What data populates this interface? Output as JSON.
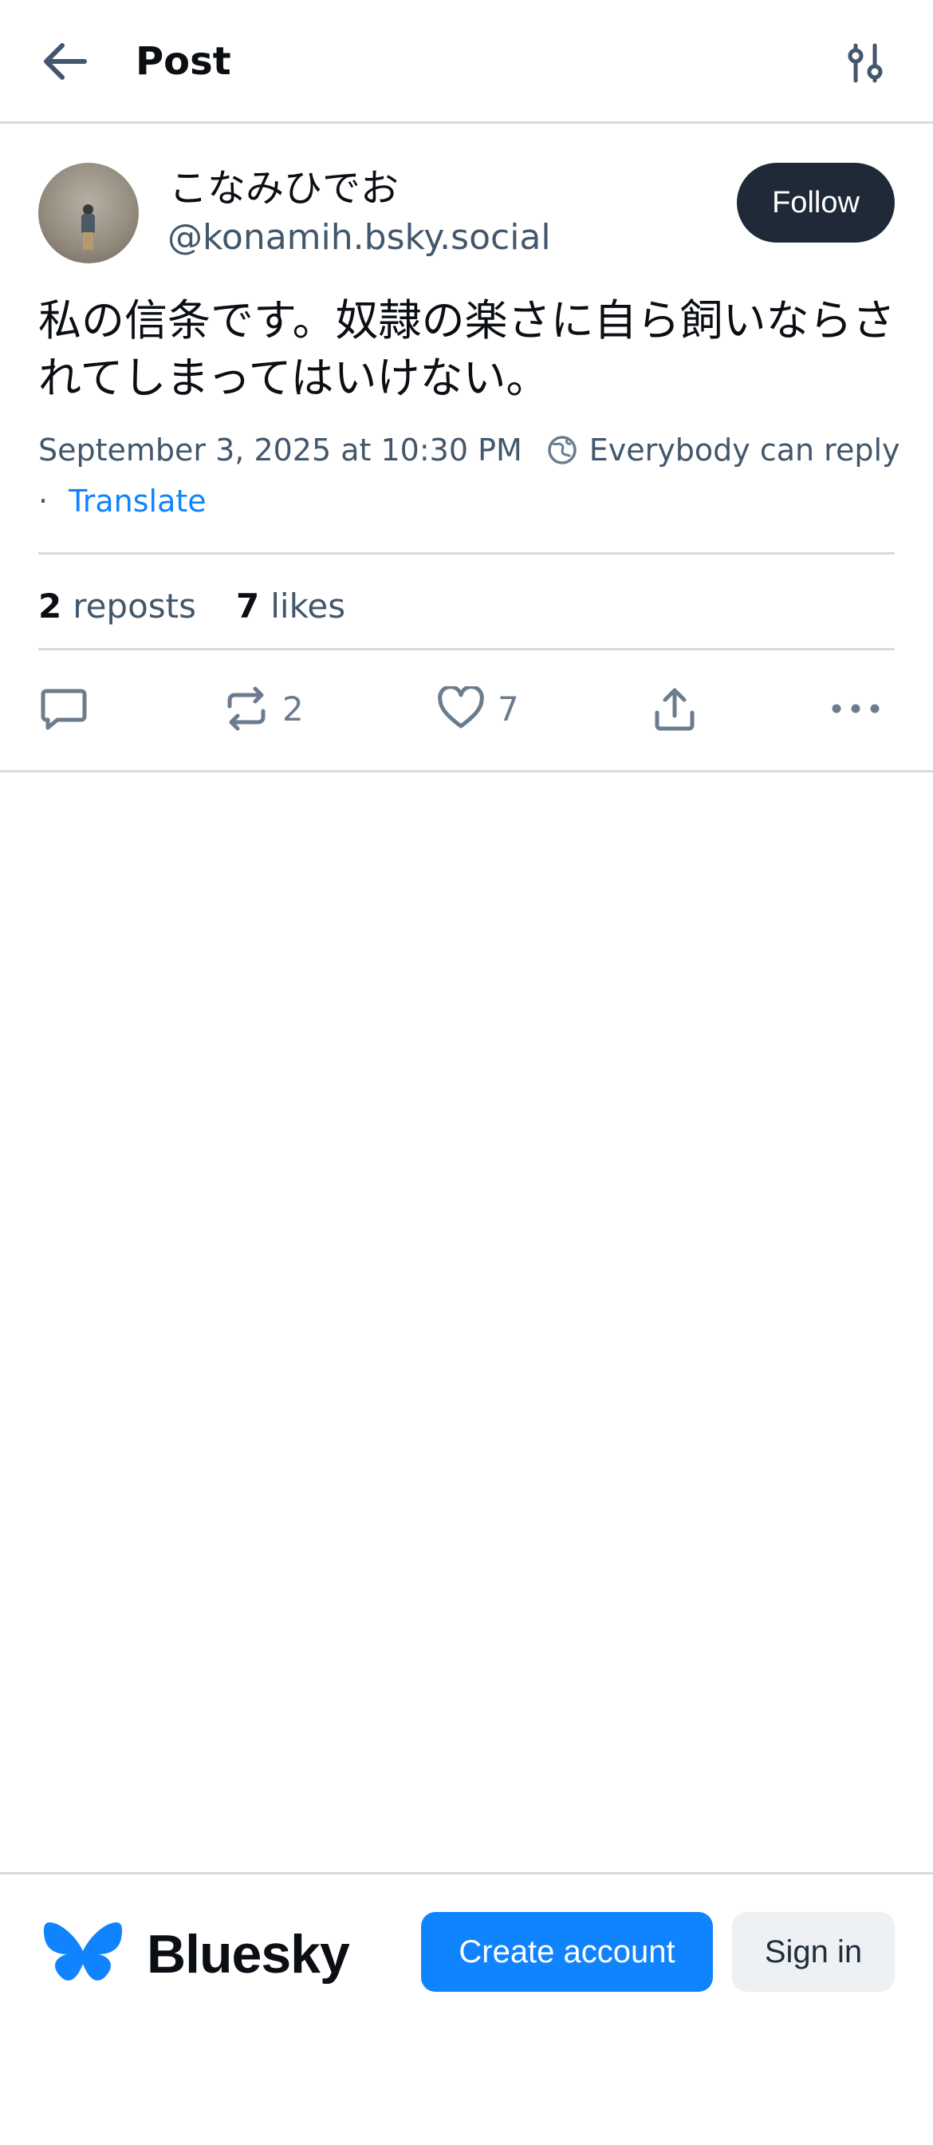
{
  "header": {
    "title": "Post",
    "back_icon": "arrow-left-icon",
    "settings_icon": "sliders-icon"
  },
  "post": {
    "author": {
      "display_name": "こなみひでお",
      "handle": "@konamih.bsky.social"
    },
    "follow_label": "Follow",
    "text": "私の信条です。奴隷の楽さに自ら飼いならされてしまってはいけない。",
    "timestamp": "September 3, 2025 at 10:30 PM",
    "reply_setting": "Everybody can reply",
    "separator": "·",
    "translate_label": "Translate",
    "stats": {
      "reposts_count": "2",
      "reposts_label": "reposts",
      "likes_count": "7",
      "likes_label": "likes"
    },
    "actions": {
      "reply_icon": "comment-icon",
      "repost_icon": "repost-icon",
      "repost_count": "2",
      "like_icon": "heart-icon",
      "like_count": "7",
      "share_icon": "share-icon",
      "more_icon": "more-horizontal-icon"
    }
  },
  "footer": {
    "brand": "Bluesky",
    "create_account_label": "Create account",
    "sign_in_label": "Sign in"
  },
  "colors": {
    "accent": "#1083fe",
    "follow_bg": "#1f2937",
    "muted_text": "#42576c",
    "border": "#d4dbe2"
  }
}
